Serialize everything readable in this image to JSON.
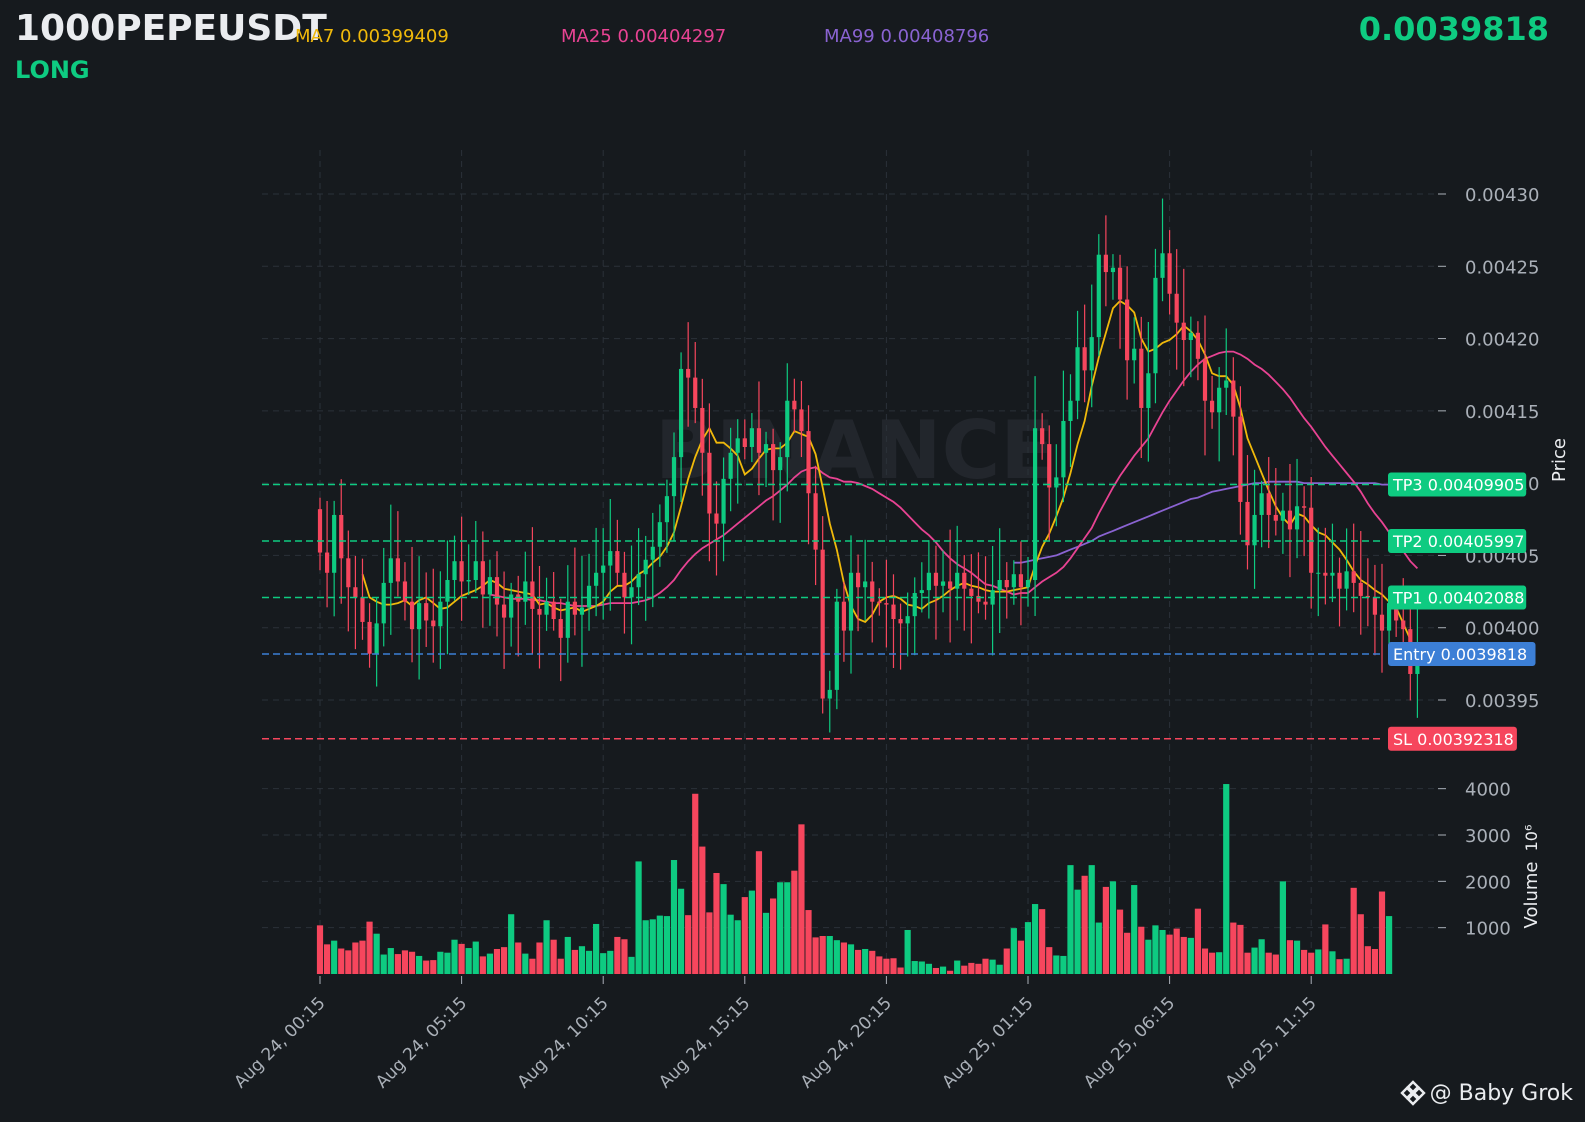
{
  "header": {
    "symbol": "1000PEPEUSDT",
    "side": "LONG",
    "last_price": "0.0039818",
    "ma7_label": "MA7 0.00399409",
    "ma25_label": "MA25 0.00404297",
    "ma99_label": "MA99 0.00408796"
  },
  "watermark": "BINANCE",
  "credit": {
    "icon": "binance-logo-icon",
    "text": "@ Baby Grok"
  },
  "colors": {
    "background": "#161a1e",
    "up": "#0ecb81",
    "down": "#f6465d",
    "ma7": "#f0b90b",
    "ma25": "#e84393",
    "ma99": "#8a63d2",
    "entry": "#3c7fd6",
    "grid": "#2b3139",
    "text": "#aab0b8"
  },
  "chart_data": {
    "type": "candlestick",
    "price_axis": {
      "label": "Price",
      "ylim": [
        0.00391,
        0.00432
      ],
      "ticks": [
        0.00395,
        0.004,
        0.00405,
        0.0041,
        0.00415,
        0.0042,
        0.00425,
        0.0043
      ],
      "tick_labels": [
        "0.00395",
        "0.00400",
        "0.00405",
        "0.00410",
        "0.00415",
        "0.00420",
        "0.00425",
        "0.00430"
      ]
    },
    "volume_axis": {
      "label": "Volume",
      "unit": "10⁶",
      "ylim": [
        0,
        4100
      ],
      "ticks": [
        1000,
        2000,
        3000,
        4000
      ],
      "tick_labels": [
        "1000",
        "2000",
        "3000",
        "4000"
      ]
    },
    "x_ticks": [
      "Aug 24, 00:15",
      "Aug 24, 05:15",
      "Aug 24, 10:15",
      "Aug 24, 15:15",
      "Aug 24, 20:15",
      "Aug 25, 01:15",
      "Aug 25, 06:15",
      "Aug 25, 11:15"
    ],
    "x_tick_index": [
      0,
      20,
      40,
      60,
      80,
      100,
      120,
      140
    ],
    "grid": true,
    "levels": [
      {
        "name": "TP3",
        "value": 0.00409905,
        "label": "TP3 0.00409905",
        "kind": "tp"
      },
      {
        "name": "TP2",
        "value": 0.00405997,
        "label": "TP2 0.00405997",
        "kind": "tp"
      },
      {
        "name": "TP1",
        "value": 0.00402088,
        "label": "TP1 0.00402088",
        "kind": "tp"
      },
      {
        "name": "Entry",
        "value": 0.0039818,
        "label": "Entry 0.0039818",
        "kind": "entry"
      },
      {
        "name": "SL",
        "value": 0.00392318,
        "label": "SL 0.00392318",
        "kind": "sl"
      }
    ],
    "close": [
      0.004052,
      0.004038,
      0.004078,
      0.004048,
      0.004028,
      0.004021,
      0.004004,
      0.003982,
      0.004003,
      0.004031,
      0.004048,
      0.004032,
      0.004018,
      0.003999,
      0.004017,
      0.004005,
      0.004001,
      0.004018,
      0.004033,
      0.004046,
      0.004032,
      0.004033,
      0.004046,
      0.004023,
      0.004035,
      0.004016,
      0.004007,
      0.004023,
      0.004018,
      0.004032,
      0.004013,
      0.004009,
      0.004018,
      0.004006,
      0.003993,
      0.004018,
      0.004009,
      0.004014,
      0.004029,
      0.004038,
      0.004043,
      0.004053,
      0.004038,
      0.004021,
      0.004028,
      0.004037,
      0.004047,
      0.004056,
      0.004073,
      0.004091,
      0.004118,
      0.004179,
      0.004173,
      0.004152,
      0.004121,
      0.004079,
      0.004072,
      0.004103,
      0.004121,
      0.004131,
      0.004125,
      0.004138,
      0.004121,
      0.004127,
      0.004109,
      0.004118,
      0.004157,
      0.004151,
      0.004136,
      0.004093,
      0.004054,
      0.003951,
      0.003957,
      0.004018,
      0.003998,
      0.004038,
      0.004028,
      0.004032,
      0.004018,
      0.004017,
      0.004016,
      0.004006,
      0.004003,
      0.004008,
      0.004024,
      0.004026,
      0.004038,
      0.004029,
      0.004032,
      0.004027,
      0.004038,
      0.004027,
      0.004022,
      0.004018,
      0.004016,
      0.004026,
      0.004033,
      0.004028,
      0.004037,
      0.004028,
      0.004033,
      0.004138,
      0.004127,
      0.004097,
      0.004104,
      0.004143,
      0.004157,
      0.004194,
      0.004178,
      0.004201,
      0.004258,
      0.004246,
      0.004249,
      0.004227,
      0.004185,
      0.004193,
      0.004152,
      0.004176,
      0.004242,
      0.004259,
      0.004231,
      0.004211,
      0.004199,
      0.004204,
      0.004186,
      0.004157,
      0.004149,
      0.004166,
      0.004171,
      0.004146,
      0.004087,
      0.004057,
      0.004078,
      0.004093,
      0.004078,
      0.004074,
      0.004081,
      0.004068,
      0.004084,
      0.004083,
      0.004038,
      0.004038,
      0.004036,
      0.004038,
      0.004027,
      0.004039,
      0.004031,
      0.004022,
      0.004021,
      0.004009,
      0.003998,
      0.004017,
      0.004005,
      0.003999,
      0.003968,
      0.003985
    ],
    "volume": [
      1050,
      640,
      720,
      550,
      510,
      680,
      720,
      1130,
      870,
      420,
      560,
      430,
      510,
      480,
      390,
      290,
      300,
      480,
      460,
      740,
      650,
      560,
      700,
      380,
      440,
      540,
      580,
      1290,
      680,
      440,
      330,
      680,
      1160,
      740,
      330,
      800,
      520,
      600,
      500,
      1080,
      450,
      500,
      800,
      750,
      370,
      2430,
      1160,
      1180,
      1260,
      1250,
      2460,
      1840,
      1270,
      3890,
      2750,
      1330,
      2180,
      1940,
      1280,
      1160,
      1660,
      1800,
      2650,
      1320,
      1630,
      1980,
      1980,
      2230,
      3230,
      1380,
      790,
      820,
      820,
      730,
      680,
      640,
      520,
      540,
      500,
      380,
      330,
      340,
      140,
      950,
      280,
      270,
      220,
      130,
      160,
      70,
      290,
      180,
      240,
      220,
      330,
      310,
      200,
      550,
      990,
      720,
      1120,
      1510,
      1400,
      580,
      400,
      390,
      2350,
      1820,
      2120,
      2350,
      1110,
      1880,
      2000,
      1390,
      890,
      1920,
      1020,
      740,
      1050,
      950,
      850,
      980,
      800,
      780,
      1410,
      550,
      460,
      470,
      4100,
      1110,
      1060,
      460,
      570,
      750,
      460,
      420,
      2000,
      730,
      720,
      520,
      460,
      530,
      1070,
      490,
      320,
      330,
      1860,
      1290,
      600,
      540,
      1780,
      1250
    ],
    "ma7": [
      null,
      null,
      null,
      null,
      null,
      null,
      0.004037,
      0.004021,
      0.004018,
      0.004016,
      0.004016,
      0.004017,
      0.004019,
      0.004015,
      0.004019,
      0.004021,
      0.004017,
      0.004013,
      0.004014,
      0.004018,
      0.004022,
      0.004024,
      0.004026,
      0.004029,
      0.004033,
      0.004031,
      0.004027,
      0.004026,
      0.004025,
      0.004024,
      0.004023,
      0.004016,
      0.004017,
      0.004014,
      0.004012,
      0.004013,
      0.004014,
      0.004011,
      0.004013,
      0.004015,
      0.004018,
      0.004025,
      0.004029,
      0.004029,
      0.004032,
      0.004037,
      0.00404,
      0.004045,
      0.004049,
      0.004056,
      0.004066,
      0.004084,
      0.004103,
      0.004118,
      0.00413,
      0.004138,
      0.004128,
      0.004128,
      0.004124,
      0.004119,
      0.004106,
      0.00411,
      0.004117,
      0.004123,
      0.004124,
      0.004124,
      0.004128,
      0.004136,
      0.004134,
      0.004132,
      0.00412,
      0.004097,
      0.004072,
      0.004054,
      0.004031,
      0.004015,
      0.004006,
      0.004004,
      0.004009,
      0.004018,
      0.004021,
      0.004022,
      0.00402,
      0.004016,
      0.004015,
      0.004013,
      0.004017,
      0.004019,
      0.004022,
      0.004026,
      0.004029,
      0.004031,
      0.004029,
      0.004028,
      0.004026,
      0.004025,
      0.004025,
      0.004025,
      0.004026,
      0.004027,
      0.004028,
      0.004043,
      0.004056,
      0.004065,
      0.004077,
      0.00409,
      0.004107,
      0.004127,
      0.004143,
      0.004167,
      0.004187,
      0.004204,
      0.004221,
      0.004226,
      0.004223,
      0.004218,
      0.0042,
      0.004191,
      0.004193,
      0.004197,
      0.004199,
      0.004203,
      0.004209,
      0.004205,
      0.004199,
      0.004189,
      0.004176,
      0.004174,
      0.004174,
      0.004168,
      0.004152,
      0.004131,
      0.004119,
      0.004107,
      0.004095,
      0.004084,
      0.004076,
      0.004071,
      0.004079,
      0.004077,
      0.004071,
      0.004066,
      0.004064,
      0.004059,
      0.004054,
      0.004047,
      0.004039,
      0.004033,
      0.00403,
      0.004026,
      0.004023,
      0.004018,
      0.004014,
      0.004003,
      0.003992
    ],
    "ma25": [
      null,
      null,
      null,
      null,
      null,
      null,
      null,
      null,
      null,
      null,
      null,
      null,
      null,
      null,
      null,
      null,
      null,
      null,
      null,
      null,
      null,
      null,
      null,
      null,
      0.004023,
      0.004022,
      0.004021,
      0.00402,
      0.00402,
      0.00402,
      0.004019,
      0.004019,
      0.004018,
      0.004017,
      0.004017,
      0.004016,
      0.004015,
      0.004015,
      0.004015,
      0.004015,
      0.004016,
      0.004017,
      0.004017,
      0.004017,
      0.004017,
      0.004018,
      0.004019,
      0.004021,
      0.004024,
      0.004028,
      0.004033,
      0.00404,
      0.004046,
      0.004051,
      0.004055,
      0.004058,
      0.004061,
      0.004064,
      0.004068,
      0.004072,
      0.004076,
      0.00408,
      0.004084,
      0.004088,
      0.004091,
      0.004095,
      0.004099,
      0.004104,
      0.004108,
      0.00411,
      0.004111,
      0.004107,
      0.004104,
      0.004103,
      0.004101,
      0.004101,
      0.0041,
      0.004098,
      0.004096,
      0.004093,
      0.00409,
      0.004087,
      0.004083,
      0.004078,
      0.004073,
      0.004068,
      0.004064,
      0.004059,
      0.004053,
      0.004048,
      0.004044,
      0.004041,
      0.004038,
      0.004034,
      0.00403,
      0.004029,
      0.004027,
      0.004025,
      0.004023,
      0.004024,
      0.004024,
      0.004028,
      0.004032,
      0.004035,
      0.004038,
      0.004042,
      0.004048,
      0.004055,
      0.004062,
      0.004069,
      0.004079,
      0.004088,
      0.004097,
      0.004105,
      0.004112,
      0.004119,
      0.004125,
      0.004131,
      0.00414,
      0.004149,
      0.004157,
      0.004164,
      0.004171,
      0.004177,
      0.004182,
      0.004186,
      0.004188,
      0.00419,
      0.004191,
      0.004191,
      0.004189,
      0.004186,
      0.004182,
      0.004179,
      0.004175,
      0.00417,
      0.004165,
      0.004159,
      0.004152,
      0.004145,
      0.004139,
      0.004132,
      0.004125,
      0.004119,
      0.004113,
      0.004107,
      0.004101,
      0.004094,
      0.004086,
      0.004079,
      0.004073,
      0.004066,
      0.00406,
      0.004053,
      0.004046,
      0.004041
    ],
    "ma99": [
      null,
      null,
      null,
      null,
      null,
      null,
      null,
      null,
      null,
      null,
      null,
      null,
      null,
      null,
      null,
      null,
      null,
      null,
      null,
      null,
      null,
      null,
      null,
      null,
      null,
      null,
      null,
      null,
      null,
      null,
      null,
      null,
      null,
      null,
      null,
      null,
      null,
      null,
      null,
      null,
      null,
      null,
      null,
      null,
      null,
      null,
      null,
      null,
      null,
      null,
      null,
      null,
      null,
      null,
      null,
      null,
      null,
      null,
      null,
      null,
      null,
      null,
      null,
      null,
      null,
      null,
      null,
      null,
      null,
      null,
      null,
      null,
      null,
      null,
      null,
      null,
      null,
      null,
      null,
      null,
      null,
      null,
      null,
      null,
      null,
      null,
      null,
      null,
      null,
      null,
      null,
      null,
      null,
      null,
      null,
      null,
      null,
      null,
      0.004045,
      0.004045,
      0.004046,
      0.004047,
      0.004048,
      0.004049,
      0.00405,
      0.004052,
      0.004054,
      0.004056,
      0.004058,
      0.00406,
      0.004063,
      0.004065,
      0.004067,
      0.004069,
      0.004071,
      0.004073,
      0.004075,
      0.004077,
      0.004079,
      0.004081,
      0.004083,
      0.004085,
      0.004087,
      0.004089,
      0.00409,
      0.004092,
      0.004094,
      0.004095,
      0.004096,
      0.004097,
      0.004098,
      0.004099,
      0.0041,
      0.0041,
      0.004101,
      0.004101,
      0.004101,
      0.004101,
      0.004101,
      0.0041,
      0.0041,
      0.0041,
      0.0041,
      0.0041,
      0.0041,
      0.0041,
      0.0041,
      0.0041,
      0.0041,
      0.0041,
      0.004099,
      0.004099,
      0.004098,
      0.004097,
      0.004096,
      0.004096,
      0.004095,
      0.004094,
      0.004092
    ]
  }
}
